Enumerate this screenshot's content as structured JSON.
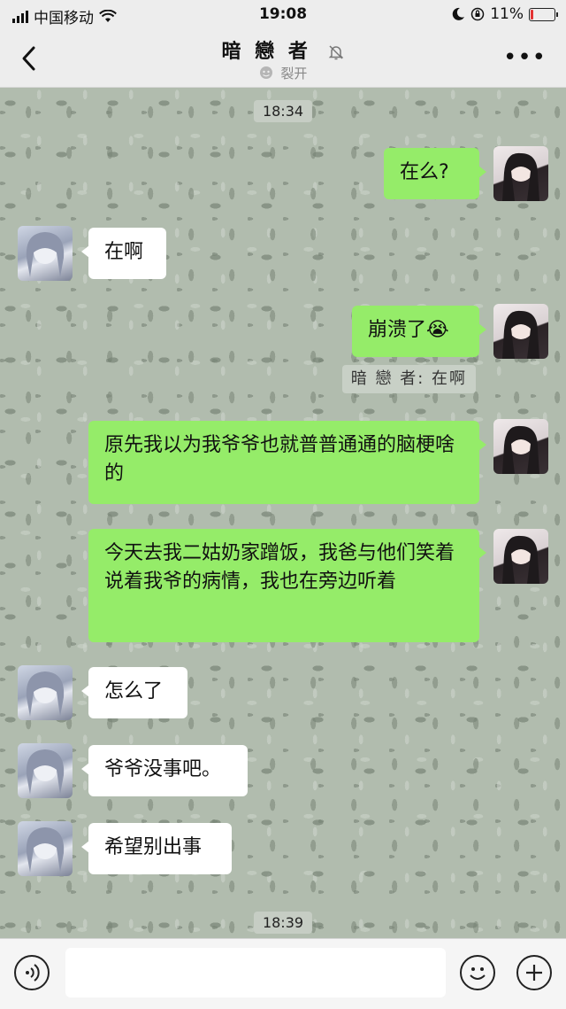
{
  "status_bar": {
    "carrier": "中国移动",
    "time": "19:08",
    "battery_text": "11%",
    "battery_level": 0.11
  },
  "header": {
    "title": "暗 戀 者",
    "subtitle": "裂开"
  },
  "messages": [
    {
      "type": "timestamp",
      "text": "18:34"
    },
    {
      "from": "me",
      "text": "在么?"
    },
    {
      "from": "friend",
      "text": "在啊"
    },
    {
      "from": "me",
      "text": "崩溃了😭"
    },
    {
      "type": "quote",
      "text": "暗 戀 者: 在啊"
    },
    {
      "from": "me",
      "text": "原先我以为我爷爷也就普普通通的脑梗啥的"
    },
    {
      "from": "me",
      "text": "今天去我二姑奶家蹭饭，我爸与他们笑着说着我爷的病情，我也在旁边听着"
    },
    {
      "from": "friend",
      "text": "怎么了"
    },
    {
      "from": "friend",
      "text": "爷爷没事吧。"
    },
    {
      "from": "friend",
      "text": "希望别出事"
    },
    {
      "type": "timestamp",
      "text": "18:39"
    }
  ],
  "colors": {
    "outgoing_bubble": "#95ec69",
    "incoming_bubble": "#ffffff",
    "battery_low": "#e33333"
  },
  "icons": {
    "back": "chevron-left-icon",
    "more": "more-dots-icon",
    "mute": "bell-muted-icon",
    "voice": "voice-icon",
    "emoji": "emoji-icon",
    "add": "plus-icon"
  }
}
